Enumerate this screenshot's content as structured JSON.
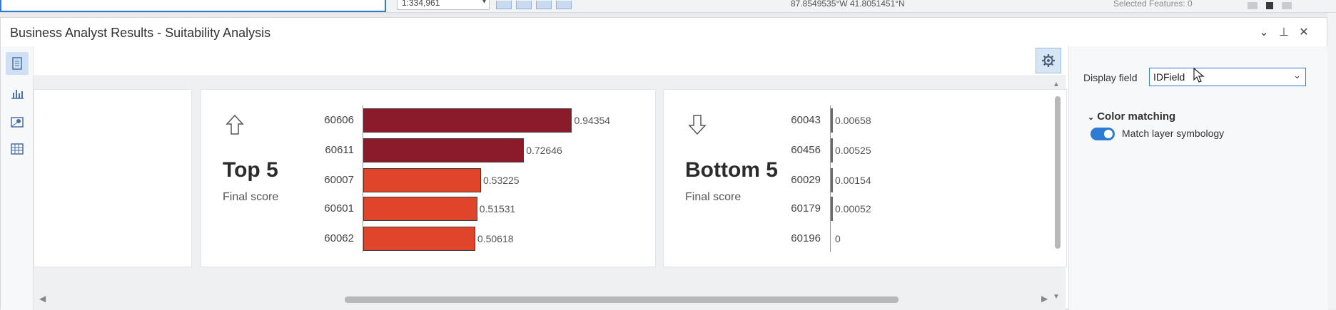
{
  "topbar": {
    "scale_value": "1:334,961",
    "coordinates": "87.8549535°W 41.8051451°N",
    "selected_features": "Selected Features: 0"
  },
  "panel": {
    "title": "Business Analyst Results - Suitability Analysis"
  },
  "top5": {
    "heading": "Top 5",
    "subtitle": "Final score",
    "rows": [
      {
        "id": "60606",
        "score": "0.94354",
        "value": 0.94354
      },
      {
        "id": "60611",
        "score": "0.72646",
        "value": 0.72646
      },
      {
        "id": "60007",
        "score": "0.53225",
        "value": 0.53225
      },
      {
        "id": "60601",
        "score": "0.51531",
        "value": 0.51531
      },
      {
        "id": "60062",
        "score": "0.50618",
        "value": 0.50618
      }
    ]
  },
  "bottom5": {
    "heading": "Bottom 5",
    "subtitle": "Final score",
    "rows": [
      {
        "id": "60043",
        "score": "0.00658",
        "value": 0.00658
      },
      {
        "id": "60456",
        "score": "0.00525",
        "value": 0.00525
      },
      {
        "id": "60029",
        "score": "0.00154",
        "value": 0.00154
      },
      {
        "id": "60179",
        "score": "0.00052",
        "value": 0.00052
      },
      {
        "id": "60196",
        "score": "0",
        "value": 0
      }
    ]
  },
  "settings": {
    "display_field_label": "Display field",
    "display_field_value": "IDField",
    "color_matching_label": "Color matching",
    "match_symbology_label": "Match layer symbology",
    "match_symbology_on": true
  },
  "colors": {
    "dark_red": "#8b1a2b",
    "orange_red": "#e0452c",
    "accent": "#2d7bd4"
  },
  "chart_data": [
    {
      "type": "bar",
      "title": "Top 5",
      "xlabel": "Final score",
      "categories": [
        "60606",
        "60611",
        "60007",
        "60601",
        "60062"
      ],
      "values": [
        0.94354,
        0.72646,
        0.53225,
        0.51531,
        0.50618
      ]
    },
    {
      "type": "bar",
      "title": "Bottom 5",
      "xlabel": "Final score",
      "categories": [
        "60043",
        "60456",
        "60029",
        "60179",
        "60196"
      ],
      "values": [
        0.00658,
        0.00525,
        0.00154,
        0.00052,
        0
      ]
    }
  ]
}
